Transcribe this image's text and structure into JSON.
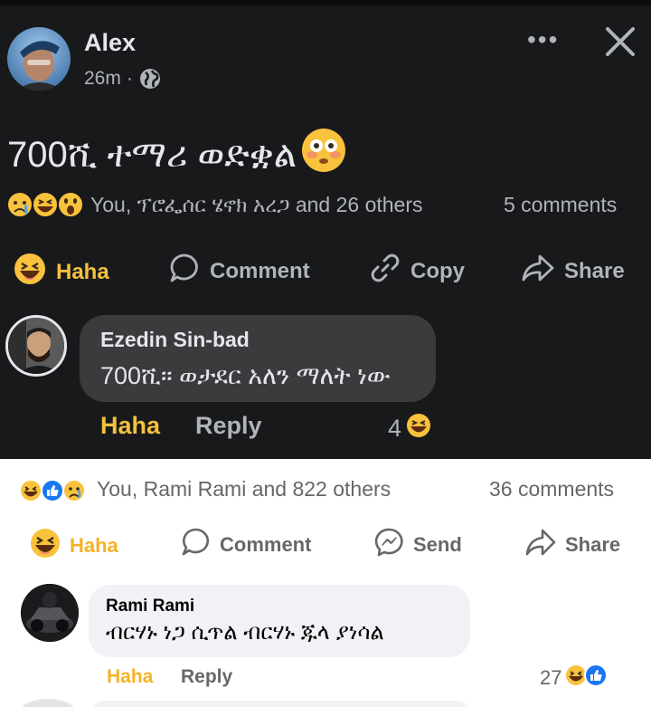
{
  "embedded_post": {
    "author": "Alex",
    "time": "26m",
    "meta_separator": "·",
    "post_text": "700ሺ ተማሪ ወድቋል",
    "reactions_text": "You, ፕሮፌሰር ሄኖክ አረጋ and 26 others",
    "comments_count": "5 comments",
    "actions": {
      "haha": "Haha",
      "comment": "Comment",
      "copy": "Copy",
      "share": "Share"
    },
    "comment": {
      "author": "Ezedin Sin-bad",
      "text": "700ሺ። ወታደር አለን ማለት ነው",
      "haha_label": "Haha",
      "reply_label": "Reply",
      "reaction_count": "4"
    }
  },
  "outer_post": {
    "reactions_text": "You, Rami Rami and 822 others",
    "comments_count": "36 comments",
    "actions": {
      "haha": "Haha",
      "comment": "Comment",
      "send": "Send",
      "share": "Share"
    },
    "comment": {
      "author": "Rami Rami",
      "text": "ብርሃኑ ነጋ ሲጥል ብርሃኑ ጁላ ያነሳል",
      "haha_label": "Haha",
      "reply_label": "Reply",
      "reaction_count": "27"
    }
  },
  "colors": {
    "dark_bg": "#18191b",
    "dark_bubble": "#3a3b3c",
    "haha_dark": "#f5c13c",
    "haha_light": "#f7b125",
    "like_blue": "#1877f2",
    "light_bubble": "#f0f2f5"
  },
  "icons": [
    "globe-icon",
    "more-options-icon",
    "close-icon",
    "haha-emoji-icon",
    "comment-icon",
    "copy-link-icon",
    "share-icon",
    "messenger-icon",
    "like-icon",
    "sad-emoji-icon",
    "wow-emoji-icon",
    "flushed-emoji-icon"
  ]
}
